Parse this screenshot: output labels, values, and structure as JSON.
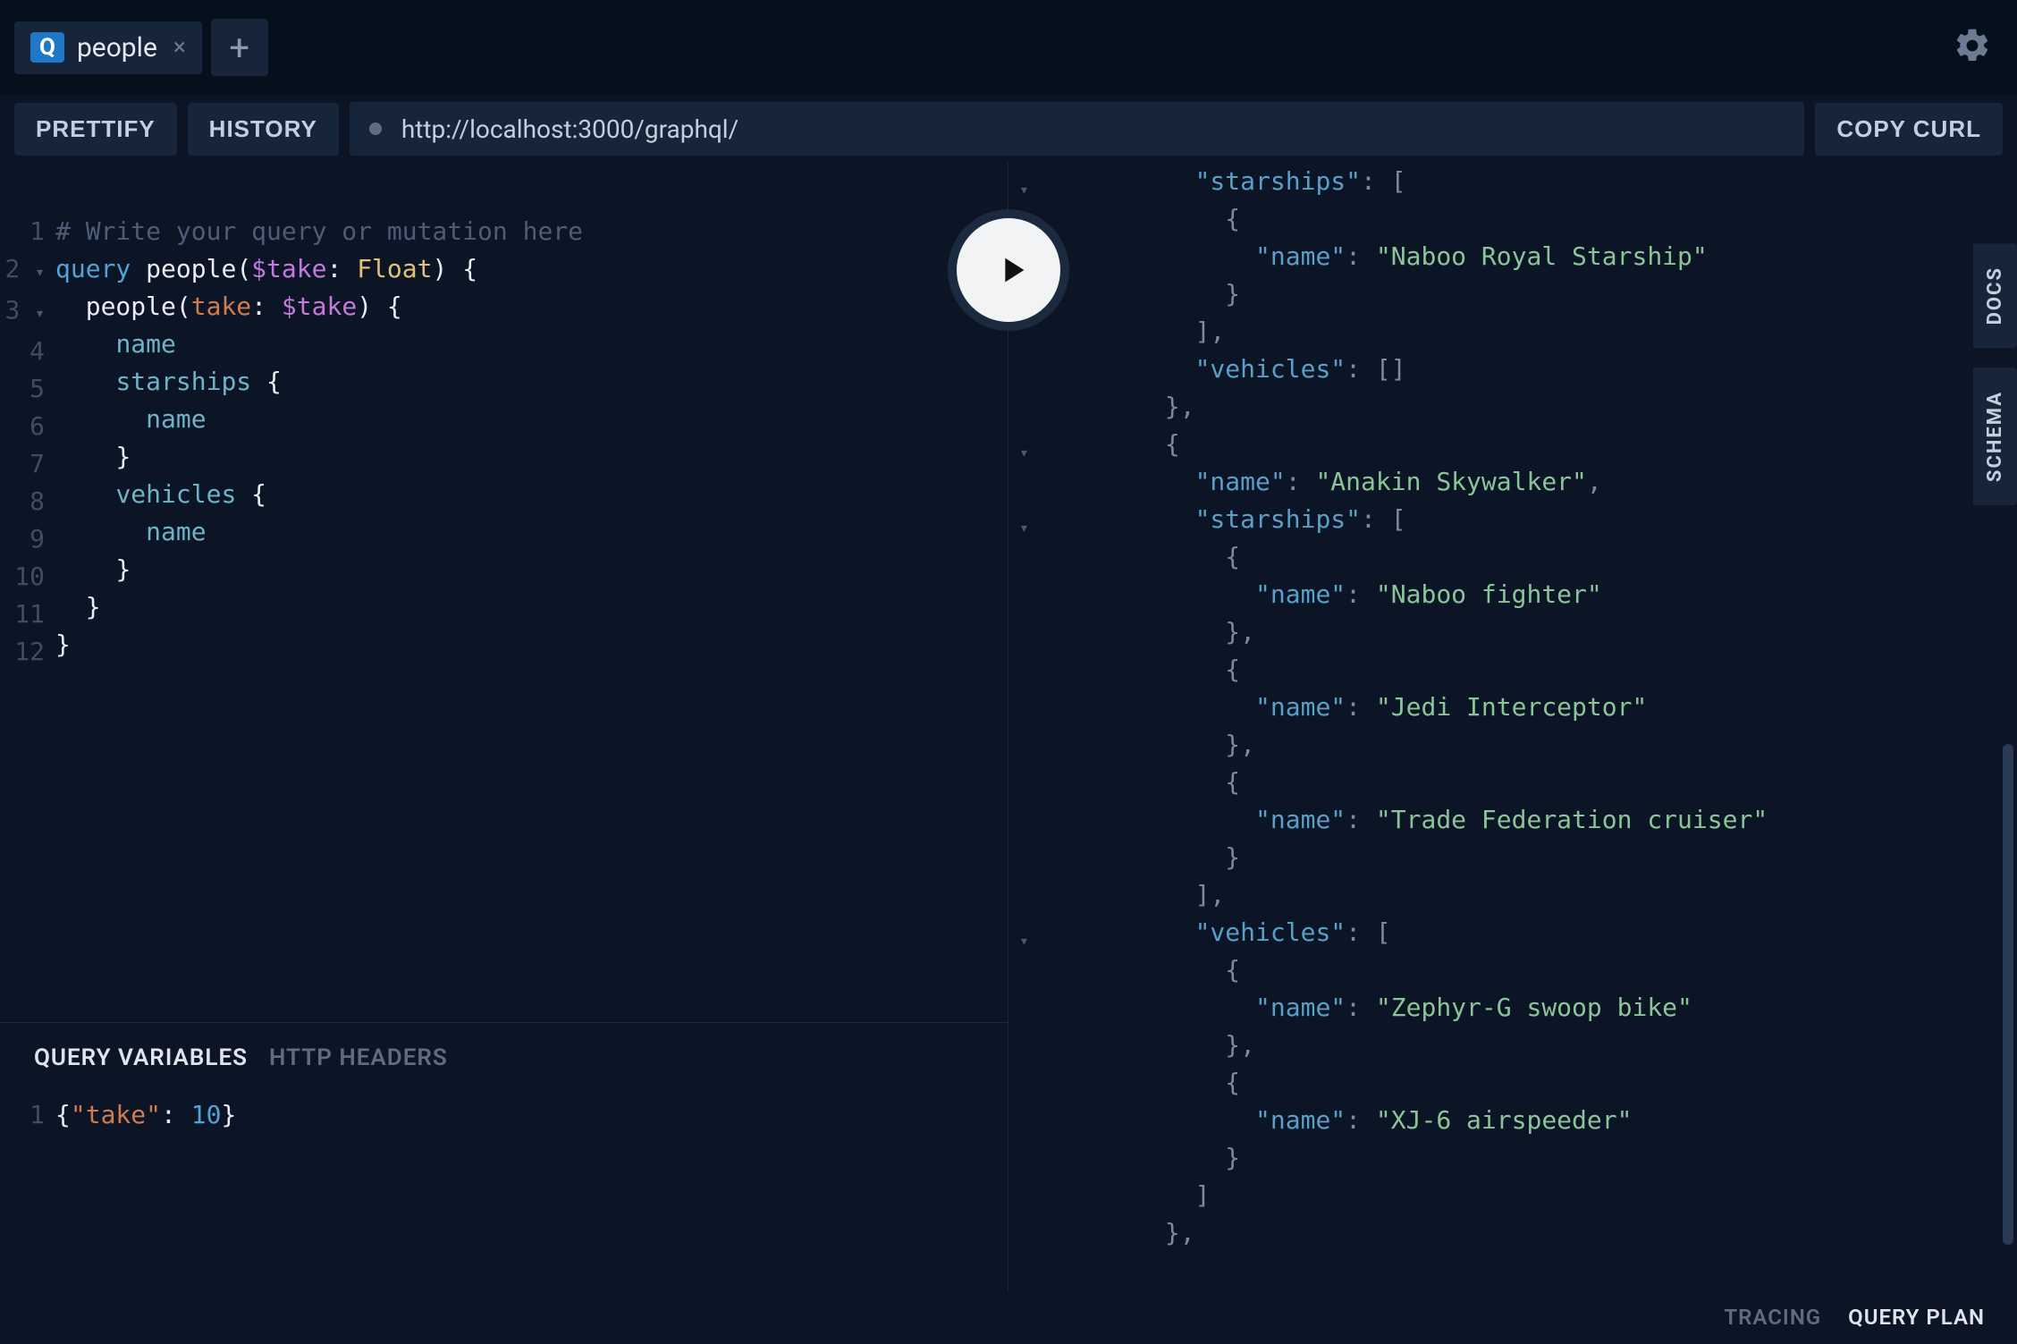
{
  "tab": {
    "badge": "Q",
    "label": "people",
    "close": "×",
    "add": "+"
  },
  "toolbar": {
    "prettify": "PRETTIFY",
    "history": "HISTORY",
    "endpoint": "http://localhost:3000/graphql/",
    "copy_curl": "COPY CURL"
  },
  "editor": {
    "line_numbers": [
      "1",
      "2",
      "3",
      "4",
      "5",
      "6",
      "7",
      "8",
      "9",
      "10",
      "11",
      "12"
    ],
    "comment": "# Write your query or mutation here",
    "tokens": {
      "query_kw": "query",
      "op_name": "people",
      "var_name": "$take",
      "var_type": "Float",
      "field_people": "people",
      "arg_name": "take",
      "arg_value": "$take",
      "field_name": "name",
      "field_starships": "starships",
      "field_vehicles": "vehicles"
    }
  },
  "variables": {
    "tab_vars": "QUERY VARIABLES",
    "tab_headers": "HTTP HEADERS",
    "line_no": "1",
    "json_key": "\"take\"",
    "json_val": "10"
  },
  "result": {
    "lines": [
      {
        "indent": 5,
        "fold": true,
        "tokens": [
          [
            "key",
            "\"starships\""
          ],
          [
            "pn",
            ": ["
          ]
        ]
      },
      {
        "indent": 6,
        "tokens": [
          [
            "pn",
            "{"
          ]
        ]
      },
      {
        "indent": 7,
        "tokens": [
          [
            "key",
            "\"name\""
          ],
          [
            "pn",
            ": "
          ],
          [
            "str",
            "\"Naboo Royal Starship\""
          ]
        ]
      },
      {
        "indent": 6,
        "tokens": [
          [
            "pn",
            "}"
          ]
        ]
      },
      {
        "indent": 5,
        "tokens": [
          [
            "pn",
            "],"
          ]
        ]
      },
      {
        "indent": 5,
        "tokens": [
          [
            "key",
            "\"vehicles\""
          ],
          [
            "pn",
            ": []"
          ]
        ]
      },
      {
        "indent": 4,
        "tokens": [
          [
            "pn",
            "},"
          ]
        ]
      },
      {
        "indent": 4,
        "fold": true,
        "tokens": [
          [
            "pn",
            "{"
          ]
        ]
      },
      {
        "indent": 5,
        "tokens": [
          [
            "key",
            "\"name\""
          ],
          [
            "pn",
            ": "
          ],
          [
            "str",
            "\"Anakin Skywalker\""
          ],
          [
            "pn",
            ","
          ]
        ]
      },
      {
        "indent": 5,
        "fold": true,
        "tokens": [
          [
            "key",
            "\"starships\""
          ],
          [
            "pn",
            ": ["
          ]
        ]
      },
      {
        "indent": 6,
        "tokens": [
          [
            "pn",
            "{"
          ]
        ]
      },
      {
        "indent": 7,
        "tokens": [
          [
            "key",
            "\"name\""
          ],
          [
            "pn",
            ": "
          ],
          [
            "str",
            "\"Naboo fighter\""
          ]
        ]
      },
      {
        "indent": 6,
        "tokens": [
          [
            "pn",
            "},"
          ]
        ]
      },
      {
        "indent": 6,
        "tokens": [
          [
            "pn",
            "{"
          ]
        ]
      },
      {
        "indent": 7,
        "tokens": [
          [
            "key",
            "\"name\""
          ],
          [
            "pn",
            ": "
          ],
          [
            "str",
            "\"Jedi Interceptor\""
          ]
        ]
      },
      {
        "indent": 6,
        "tokens": [
          [
            "pn",
            "},"
          ]
        ]
      },
      {
        "indent": 6,
        "tokens": [
          [
            "pn",
            "{"
          ]
        ]
      },
      {
        "indent": 7,
        "tokens": [
          [
            "key",
            "\"name\""
          ],
          [
            "pn",
            ": "
          ],
          [
            "str",
            "\"Trade Federation cruiser\""
          ]
        ]
      },
      {
        "indent": 6,
        "tokens": [
          [
            "pn",
            "}"
          ]
        ]
      },
      {
        "indent": 5,
        "tokens": [
          [
            "pn",
            "],"
          ]
        ]
      },
      {
        "indent": 5,
        "fold": true,
        "tokens": [
          [
            "key",
            "\"vehicles\""
          ],
          [
            "pn",
            ": ["
          ]
        ]
      },
      {
        "indent": 6,
        "tokens": [
          [
            "pn",
            "{"
          ]
        ]
      },
      {
        "indent": 7,
        "tokens": [
          [
            "key",
            "\"name\""
          ],
          [
            "pn",
            ": "
          ],
          [
            "str",
            "\"Zephyr-G swoop bike\""
          ]
        ]
      },
      {
        "indent": 6,
        "tokens": [
          [
            "pn",
            "},"
          ]
        ]
      },
      {
        "indent": 6,
        "tokens": [
          [
            "pn",
            "{"
          ]
        ]
      },
      {
        "indent": 7,
        "tokens": [
          [
            "key",
            "\"name\""
          ],
          [
            "pn",
            ": "
          ],
          [
            "str",
            "\"XJ-6 airspeeder\""
          ]
        ]
      },
      {
        "indent": 6,
        "tokens": [
          [
            "pn",
            "}"
          ]
        ]
      },
      {
        "indent": 5,
        "tokens": [
          [
            "pn",
            "]"
          ]
        ]
      },
      {
        "indent": 4,
        "tokens": [
          [
            "pn",
            "},"
          ]
        ]
      }
    ]
  },
  "docks": {
    "docs": "DOCS",
    "schema": "SCHEMA"
  },
  "footer": {
    "tracing": "TRACING",
    "query_plan": "QUERY PLAN"
  }
}
